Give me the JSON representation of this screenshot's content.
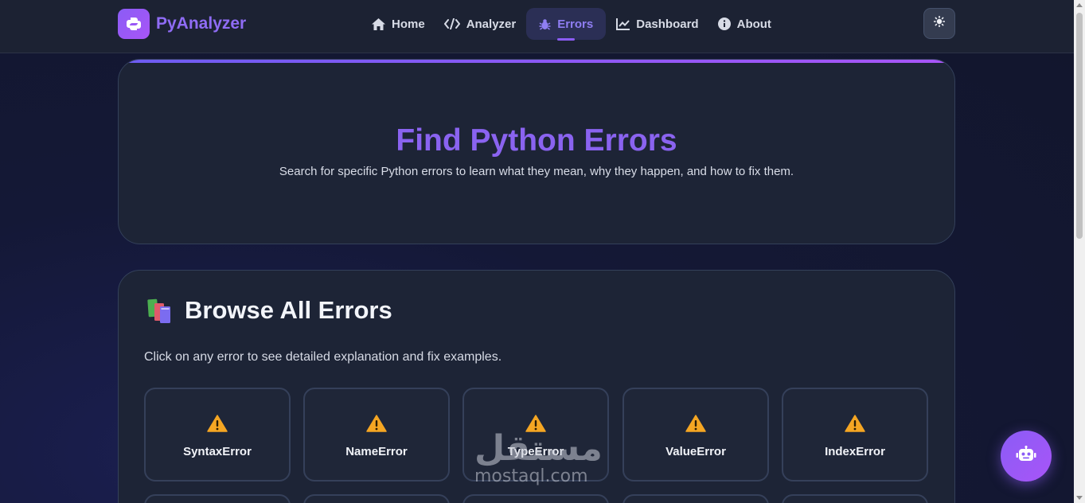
{
  "nav": {
    "brand": "PyAnalyzer",
    "links": [
      {
        "label": "Home",
        "icon": "home-icon"
      },
      {
        "label": "Analyzer",
        "icon": "code-icon"
      },
      {
        "label": "Errors",
        "icon": "bug-icon",
        "active": true
      },
      {
        "label": "Dashboard",
        "icon": "chart-line-icon"
      },
      {
        "label": "About",
        "icon": "info-icon"
      }
    ],
    "theme_toggle_icon": "sun-icon"
  },
  "hero": {
    "title": "Find Python Errors",
    "subtitle": "Search for specific Python errors to learn what they mean, why they happen, and how to fix them."
  },
  "browse": {
    "title": "Browse All Errors",
    "icon": "books-emoji",
    "description": "Click on any error to see detailed explanation and fix examples.",
    "errors": [
      "SyntaxError",
      "NameError",
      "TypeError",
      "ValueError",
      "IndexError"
    ]
  },
  "watermark": {
    "arabic": "مستقل",
    "latin": "mostaql.com"
  },
  "colors": {
    "accent": "#8b5cf6",
    "warning": "#f5a623"
  }
}
